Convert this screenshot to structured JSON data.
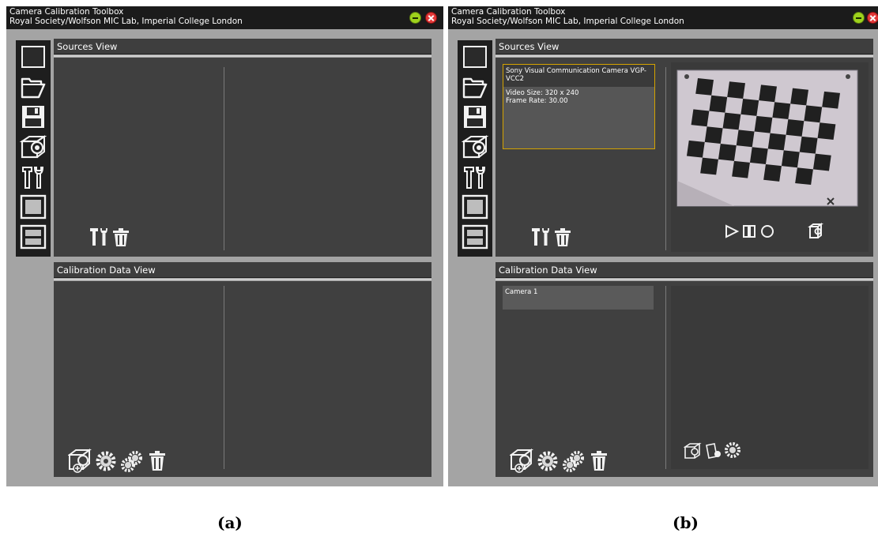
{
  "window": {
    "title_line1": "Camera Calibration Toolbox",
    "title_line2": "Royal Society/Wolfson MIC Lab, Imperial College London"
  },
  "sections": {
    "sources_view": "Sources View",
    "calibration_data_view": "Calibration Data View"
  },
  "toolbar_icons": [
    "window-icon",
    "folder-open-icon",
    "save-disk-icon",
    "camera-icon",
    "tools-icon",
    "single-view-icon",
    "split-view-icon"
  ],
  "source": {
    "name": "Sony Visual Communication Camera VGP-VCC2",
    "video_size": "Video Size: 320 x 240",
    "frame_rate": "Frame Rate: 30.00"
  },
  "calibration": {
    "camera_item": "Camera 1"
  },
  "captions": {
    "a": "(a)",
    "b": "(b)"
  },
  "colors": {
    "titlebar": "#1b1b1b",
    "window_bg": "#a4a4a4",
    "panel_bg": "#404040",
    "selection_border": "#d4a300",
    "minimize": "#9ed21c",
    "close": "#e33838"
  }
}
